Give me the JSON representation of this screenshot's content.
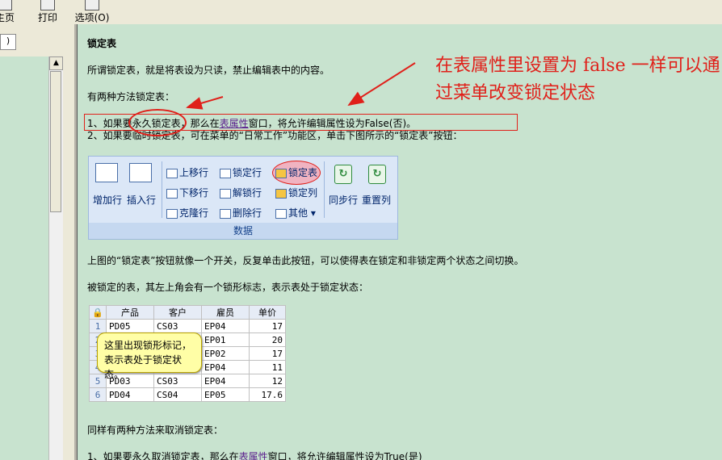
{
  "toolbar": {
    "home_label": "主页",
    "print_label": "打印",
    "options_label": "选项(O)"
  },
  "left_pane": {
    "tab_label": ")"
  },
  "content": {
    "title": "锁定表",
    "para1": "所谓锁定表，就是将表设为只读，禁止编辑表中的内容。",
    "para2": "有两种方法锁定表：",
    "line1_a": "1、如果要永久锁定表，那么在",
    "line1_link": "表属性",
    "line1_b": "窗口，将允许编辑属性设为False(否)。",
    "line2": "2、如果要临时锁定表，可在菜单的“日常工作”功能区，单击下图所示的“锁定表”按钮：",
    "para3": "上图的“锁定表”按钮就像一个开关，反复单击此按钮，可以使得表在锁定和非锁定两个状态之间切换。",
    "para4": "被锁定的表，其左上角会有一个锁形标志，表示表处于锁定状态：",
    "para5": "同样有两种方法来取消锁定表：",
    "line3_a": "1、如果要永久取消锁定表，那么在",
    "line3_link": "表属性",
    "line3_b": "窗口，将允许编辑属性设为True(是)"
  },
  "annotation": {
    "text": "在表属性里设置为 false 一样可以通过菜单改变锁定状态",
    "color": "#e0201a"
  },
  "ribbon": {
    "add_row": "增加行",
    "insert_row": "插入行",
    "move_up": "上移行",
    "move_down": "下移行",
    "clone_row": "克隆行",
    "lock_row": "锁定行",
    "unlock_row": "解锁行",
    "delete_row": "删除行",
    "lock_table": "锁定表",
    "lock_column": "锁定列",
    "other": "其他",
    "sync_row": "同步行",
    "reset_column": "重置列",
    "group_label": "数据"
  },
  "table": {
    "headers": [
      "产品",
      "客户",
      "雇员",
      "单价"
    ],
    "rows": [
      {
        "n": "1",
        "c": [
          "PD05",
          "CS03",
          "EP04",
          "17"
        ]
      },
      {
        "n": "2",
        "c": [
          "",
          "",
          "EP01",
          "20"
        ]
      },
      {
        "n": "3",
        "c": [
          "",
          "",
          "EP02",
          "17"
        ]
      },
      {
        "n": "4",
        "c": [
          "",
          "",
          "EP04",
          "11"
        ]
      },
      {
        "n": "5",
        "c": [
          "PD03",
          "CS03",
          "EP04",
          "12"
        ]
      },
      {
        "n": "6",
        "c": [
          "PD04",
          "CS04",
          "EP05",
          "17.6"
        ]
      }
    ]
  },
  "tooltip": {
    "text": "这里出现锁形标记，表示表处于锁定状态。"
  }
}
